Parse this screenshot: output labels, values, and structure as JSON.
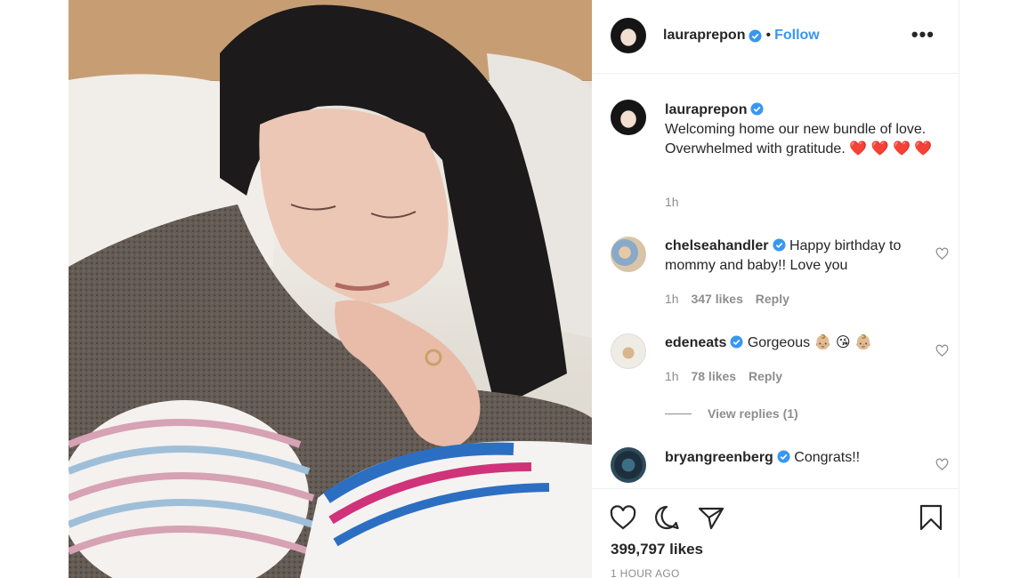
{
  "post_image": {
    "alt": "mother kissing newborn's hand"
  },
  "header": {
    "username": "lauraprepon",
    "dot": "•",
    "follow_label": "Follow",
    "more_label": "•••"
  },
  "caption": {
    "username": "lauraprepon",
    "text": "Welcoming home our new bundle of love. Overwhelmed with gratitude. ❤️ ❤️ ❤️ ❤️",
    "time": "1h"
  },
  "comments": [
    {
      "username": "chelseahandler",
      "text": "Happy birthday to mommy and baby!! Love you",
      "time": "1h",
      "likes": "347 likes",
      "reply_label": "Reply"
    },
    {
      "username": "edeneats",
      "text": "Gorgeous 👶🏼 😘 👶🏼",
      "time": "1h",
      "likes": "78 likes",
      "reply_label": "Reply",
      "view_replies": "View replies (1)"
    },
    {
      "username": "bryangreenberg",
      "text": "Congrats!!"
    }
  ],
  "footer": {
    "likes": "399,797 likes",
    "time_ago": "1 HOUR AGO"
  },
  "colors": {
    "link": "#3897f0",
    "verified": "#3897f0",
    "text": "#262626",
    "muted": "#8e8e8e"
  }
}
